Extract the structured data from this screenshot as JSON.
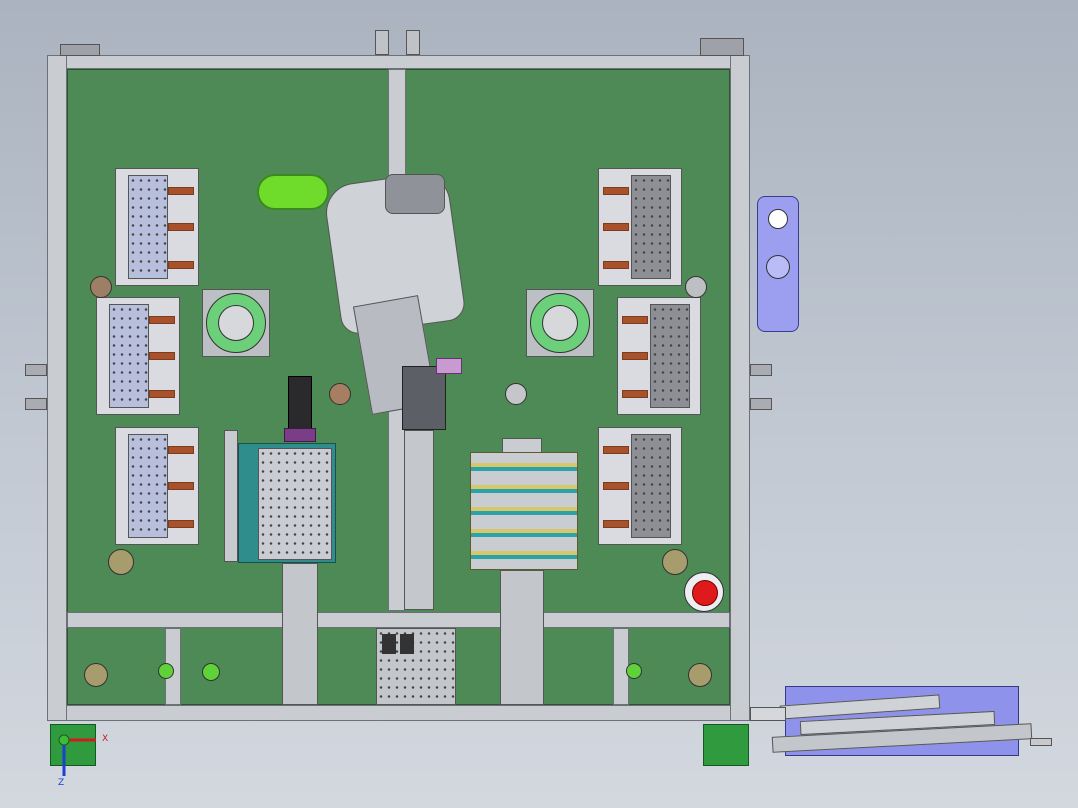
{
  "axis_triad": {
    "x_label": "X",
    "z_label": "Z"
  },
  "colors": {
    "background": "#b8c0ca",
    "base_plate": "#4e8a55",
    "frame": "#c9ccd1",
    "fixture_light": "#b7bfdc",
    "fixture_dark": "#8d8f95",
    "clamp": "#a8512b",
    "emergency_stop": "#e01a1a",
    "blue_assembly": "#8f92ea",
    "green_indicator": "#5fd23a",
    "feet": "#2f9a3e"
  }
}
